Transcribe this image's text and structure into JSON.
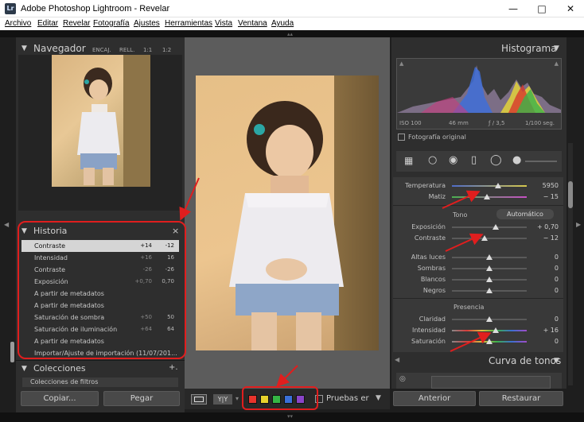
{
  "window": {
    "title": "Adobe Photoshop Lightroom - Revelar",
    "app_icon": "Lr"
  },
  "menu": [
    "Archivo",
    "Editar",
    "Revelar",
    "Fotografía",
    "Ajustes",
    "Herramientas",
    "Vista",
    "Ventana",
    "Ayuda"
  ],
  "navigator": {
    "title": "Navegador",
    "options": [
      "ENCAJ.",
      "RELL.",
      "1:1",
      "1:2"
    ]
  },
  "history": {
    "title": "Historia",
    "close_glyph": "×",
    "items": [
      {
        "label": "Contraste",
        "v1": "+14",
        "v2": "-12",
        "selected": true
      },
      {
        "label": "Intensidad",
        "v1": "+16",
        "v2": "16"
      },
      {
        "label": "Contraste",
        "v1": "-26",
        "v2": "-26"
      },
      {
        "label": "Exposición",
        "v1": "+0,70",
        "v2": "0,70"
      },
      {
        "label": "A partir de metadatos",
        "v1": "",
        "v2": ""
      },
      {
        "label": "A partir de metadatos",
        "v1": "",
        "v2": ""
      },
      {
        "label": "Saturación de sombra",
        "v1": "+50",
        "v2": "50"
      },
      {
        "label": "Saturación de iluminación",
        "v1": "+64",
        "v2": "64"
      },
      {
        "label": "A partir de metadatos",
        "v1": "",
        "v2": ""
      },
      {
        "label": "Importar/Ajuste de importación (11/07/201...",
        "v1": "",
        "v2": ""
      }
    ]
  },
  "collections": {
    "title": "Colecciones",
    "add_glyph": "+.",
    "first_item": "Colecciones de filtros"
  },
  "left_buttons": {
    "copy": "Copiar...",
    "paste": "Pegar"
  },
  "toolbar": {
    "view_glyph": "Y|Y",
    "softproof_label": "Pruebas er",
    "colors": [
      "#e8342c",
      "#e8d22c",
      "#35b544",
      "#3a6fd8",
      "#8a45c8"
    ]
  },
  "histogram": {
    "title": "Histograma",
    "iso": "ISO 100",
    "focal": "46 mm",
    "aperture": "ƒ / 3,5",
    "shutter": "1/100 seg.",
    "original_label": "Fotografía original"
  },
  "basic": {
    "tone_label": "Tono",
    "auto_label": "Automático",
    "presence_label": "Presencia",
    "sliders": [
      {
        "label": "Temperatura",
        "value": "5950",
        "pos": 0.62
      },
      {
        "label": "Matiz",
        "value": "− 15",
        "pos": 0.47
      },
      {
        "label": "Exposición",
        "value": "+ 0,70",
        "pos": 0.58
      },
      {
        "label": "Contraste",
        "value": "− 12",
        "pos": 0.44
      },
      {
        "label": "Altas luces",
        "value": "0",
        "pos": 0.5
      },
      {
        "label": "Sombras",
        "value": "0",
        "pos": 0.5
      },
      {
        "label": "Blancos",
        "value": "0",
        "pos": 0.5
      },
      {
        "label": "Negros",
        "value": "0",
        "pos": 0.5
      },
      {
        "label": "Claridad",
        "value": "0",
        "pos": 0.5
      },
      {
        "label": "Intensidad",
        "value": "+ 16",
        "pos": 0.58
      },
      {
        "label": "Saturación",
        "value": "0",
        "pos": 0.5
      }
    ]
  },
  "curve": {
    "title": "Curva de tonos"
  },
  "right_buttons": {
    "previous": "Anterior",
    "reset": "Restaurar"
  }
}
